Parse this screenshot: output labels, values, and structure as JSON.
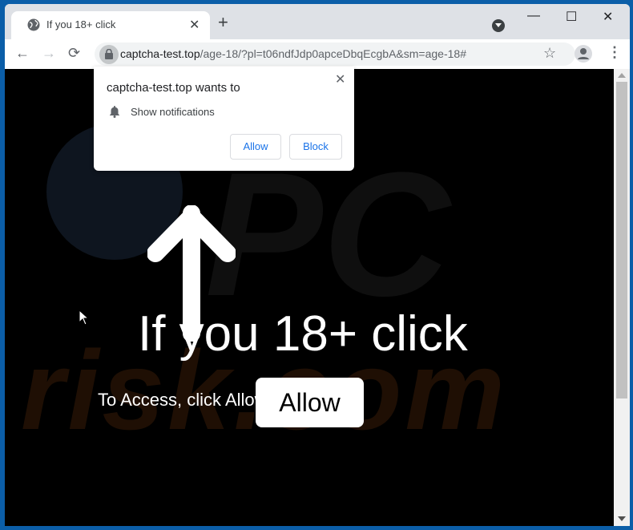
{
  "browser": {
    "tab": {
      "title": "If you 18+ click",
      "icon": "globe-icon"
    },
    "new_tab_label": "+",
    "window_controls": {
      "minimize": "—",
      "maximize": "☐",
      "close": "✕"
    },
    "nav": {
      "back": "←",
      "forward": "→",
      "reload": "⟳"
    },
    "url": {
      "domain": "captcha-test.top",
      "path": "/age-18/?pl=t06ndfJdp0apceDbqEcgbA&sm=age-18#"
    },
    "star": "☆",
    "menu": "⋮"
  },
  "permission_popup": {
    "title": "captcha-test.top wants to",
    "permission": "Show notifications",
    "allow_label": "Allow",
    "block_label": "Block",
    "close": "✕"
  },
  "page": {
    "headline": "If you 18+ click",
    "subline": "To Access, click Allow",
    "allow_button": "Allow",
    "watermark": "risk.com"
  },
  "colors": {
    "frame": "#0b5ea8",
    "accent": "#1a73e8"
  }
}
